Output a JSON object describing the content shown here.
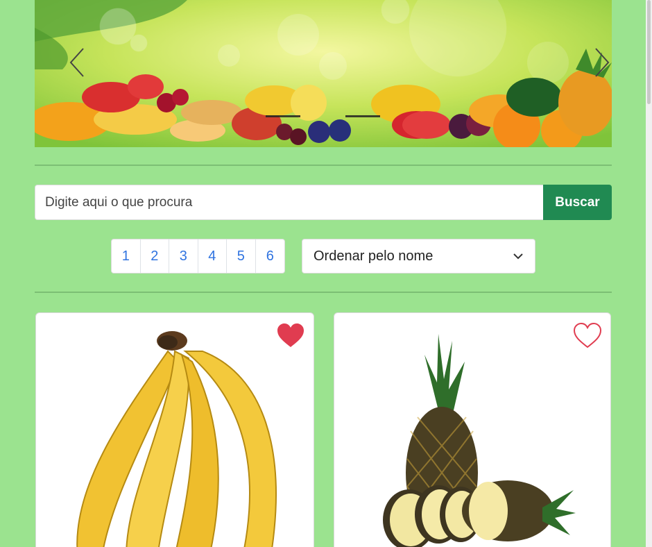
{
  "carousel": {
    "prev_icon": "chevron-left-icon",
    "next_icon": "chevron-right-icon",
    "slides": 2
  },
  "search": {
    "placeholder": "Digite aqui o que procura",
    "button_label": "Buscar"
  },
  "pagination": {
    "pages": [
      "1",
      "2",
      "3",
      "4",
      "5",
      "6"
    ]
  },
  "sort": {
    "selected": "Ordenar pelo nome"
  },
  "products": [
    {
      "image": "banana",
      "favorite": true
    },
    {
      "image": "pineapple",
      "favorite": false
    }
  ],
  "colors": {
    "background": "#9be38f",
    "accent_button": "#208a52",
    "link": "#2f73e0",
    "heart": "#e03c50"
  }
}
